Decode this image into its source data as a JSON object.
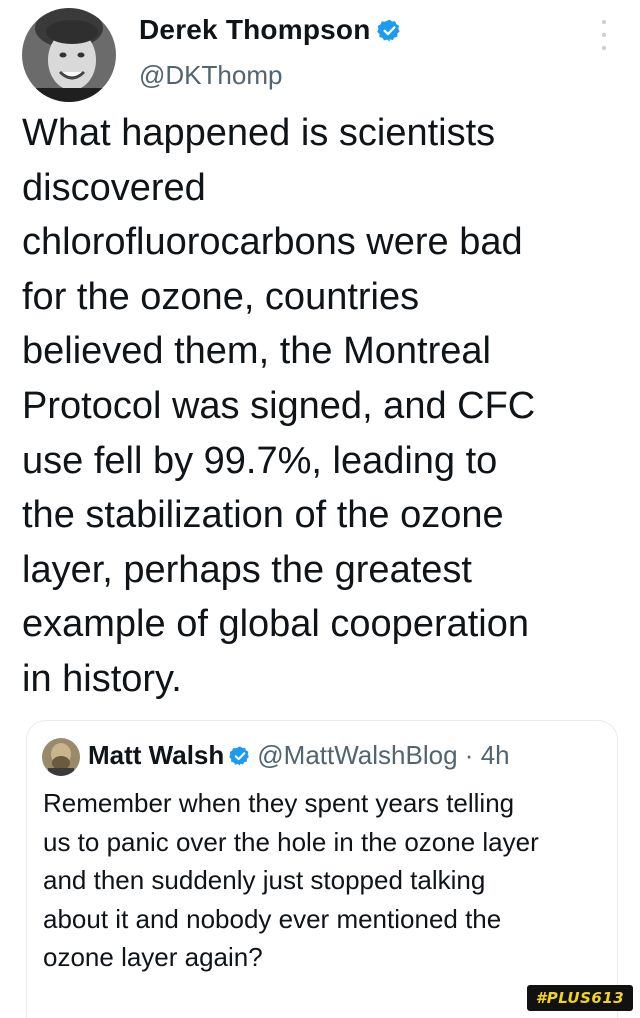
{
  "tweet": {
    "author": {
      "name": "Derek Thompson",
      "handle": "@DKThomp"
    },
    "text_lines": [
      "What happened is scientists",
      "discovered",
      "chlorofluorocarbons were bad",
      "for the ozone, countries",
      "believed them, the Montreal",
      "Protocol was signed, and CFC",
      "use fell by 99.7%, leading to",
      "the stabilization of the ozone",
      "layer, perhaps the greatest",
      "example of global cooperation",
      "in history."
    ]
  },
  "quoted_tweet": {
    "author": {
      "name": "Matt Walsh",
      "handle": "@MattWalshBlog",
      "separator": "·",
      "time": "4h"
    },
    "text_lines": [
      "Remember when they spent years telling",
      "us to panic over the hole in the ozone layer",
      "and then suddenly just stopped talking",
      "about it and nobody ever mentioned the",
      "ozone layer again?"
    ]
  },
  "watermark": {
    "text": "#PLUS613"
  },
  "icons": {
    "verified": "verified-badge-icon",
    "more": "more-options-icon"
  },
  "colors": {
    "verified_blue": "#1d9bf0",
    "secondary_text": "#536471",
    "primary_text": "#0f1419"
  }
}
